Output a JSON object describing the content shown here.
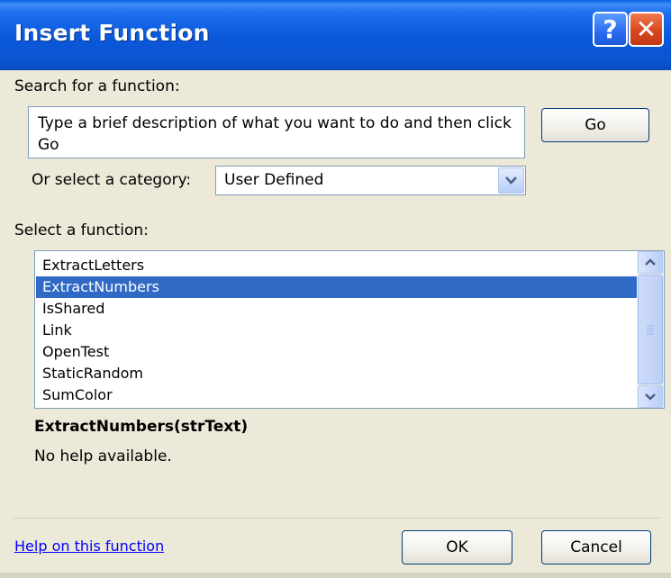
{
  "window": {
    "title": "Insert Function"
  },
  "titlebar": {
    "help_glyph": "?",
    "close_glyph": "✕"
  },
  "search": {
    "label": "Search for a function:",
    "value": "Type a brief description of what you want to do and then click Go",
    "go_label": "Go"
  },
  "category": {
    "label": "Or select a category:",
    "selected": "User Defined"
  },
  "functions": {
    "label": "Select a function:",
    "items": [
      "ExtractLetters",
      "ExtractNumbers",
      "IsShared",
      "Link",
      "OpenTest",
      "StaticRandom",
      "SumColor"
    ],
    "selected": "ExtractNumbers"
  },
  "details": {
    "signature": "ExtractNumbers(strText)",
    "help": "No help available."
  },
  "footer": {
    "help_link": "Help on this function",
    "ok_label": "OK",
    "cancel_label": "Cancel"
  },
  "colors": {
    "titlebar": "#0a58da",
    "selection": "#316ac5",
    "dialog_bg": "#ece9d8",
    "link": "#0000ff"
  }
}
